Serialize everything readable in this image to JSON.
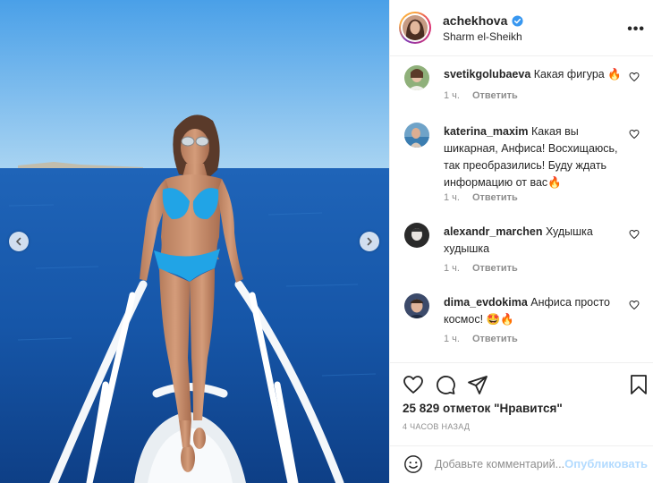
{
  "post": {
    "author": "achekhova",
    "location": "Sharm el-Sheikh",
    "more_label": "•••"
  },
  "comments": [
    {
      "user": "svetikgolubaeva",
      "text": "Какая фигура 🔥",
      "time": "1 ч.",
      "reply": "Ответить"
    },
    {
      "user": "katerina_maxim",
      "text": "Какая вы шикарная, Анфиса! Восхищаюсь, так преобразились! Буду ждать информацию от вас🔥",
      "time": "1 ч.",
      "reply": "Ответить"
    },
    {
      "user": "alexandr_marchen",
      "text": "Худышка худышка",
      "time": "1 ч.",
      "reply": "Ответить"
    },
    {
      "user": "dima_evdokima",
      "text": "Анфиса просто космос! 🤩🔥",
      "time": "1 ч.",
      "reply": "Ответить"
    }
  ],
  "likes": {
    "text": "25 829 отметок \"Нравится\""
  },
  "time_ago": "4 ЧАСОВ НАЗАД",
  "add_comment": {
    "placeholder": "Добавьте комментарий...",
    "post_label": "Опубликовать"
  },
  "icons": [
    "chevron-left-icon",
    "chevron-right-icon",
    "verified-icon",
    "heart-icon",
    "comment-icon",
    "share-icon",
    "bookmark-icon",
    "smiley-icon"
  ],
  "colors": {
    "verified": "#3897f0",
    "post_button": "#b3dbff",
    "meta_text": "#8e8e8e",
    "text": "#262626"
  }
}
